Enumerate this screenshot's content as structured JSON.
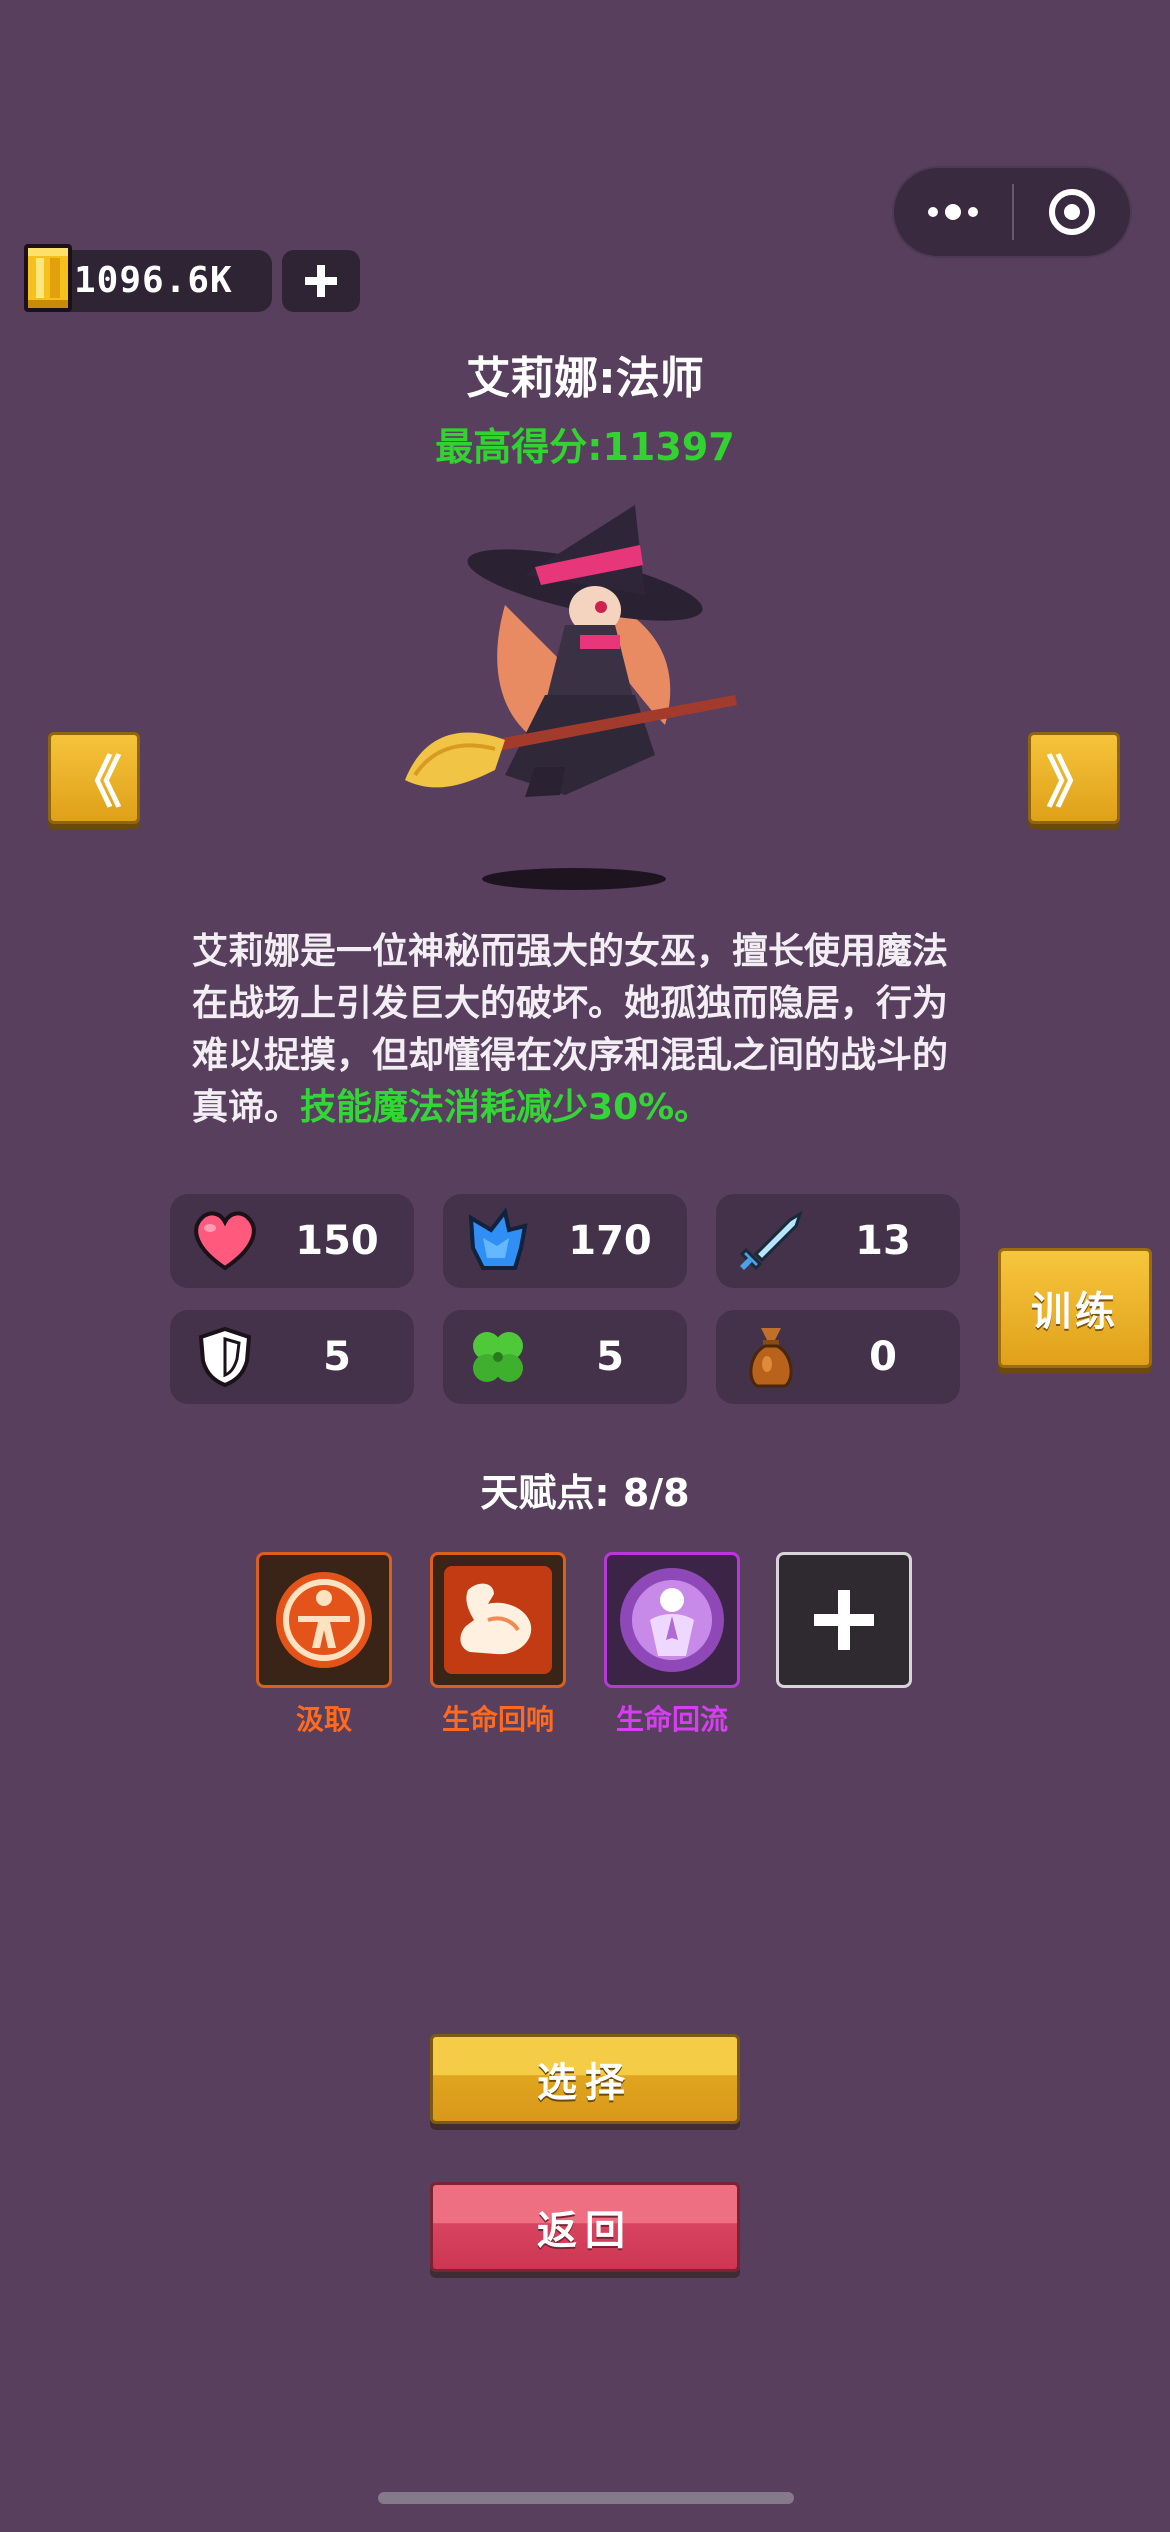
{
  "currency": {
    "amount": "1096.6K"
  },
  "character": {
    "name": "艾莉娜:法师",
    "best_score": "最高得分:11397",
    "description": "艾莉娜是一位神秘而强大的女巫，擅长使用魔法在战场上引发巨大的破坏。她孤独而隐居，行为难以捉摸，但却懂得在次序和混乱之间的战斗的真谛。",
    "skill_highlight": "技能魔法消耗减少30%。"
  },
  "stats": [
    {
      "icon": "heart-icon",
      "value": "150"
    },
    {
      "icon": "mana-crystal-icon",
      "value": "170"
    },
    {
      "icon": "sword-icon",
      "value": "13"
    },
    {
      "icon": "shield-icon",
      "value": "5"
    },
    {
      "icon": "clover-icon",
      "value": "5"
    },
    {
      "icon": "money-bag-icon",
      "value": "0"
    }
  ],
  "buttons": {
    "train": "训练",
    "select": "选择",
    "back": "返回",
    "prev": "《",
    "next": "》"
  },
  "talents": {
    "title": "天赋点: 8/8",
    "items": [
      {
        "label": "汲取",
        "color": "#ff6a1f",
        "icon": "vitruvian-icon"
      },
      {
        "label": "生命回响",
        "color": "#ff6a1f",
        "icon": "muscle-arm-icon"
      },
      {
        "label": "生命回流",
        "color": "#d63ff0",
        "icon": "praying-angel-icon"
      }
    ]
  },
  "colors": {
    "background": "#573f5d",
    "highlight_green": "#32d231",
    "gold_button": "#e7ab22",
    "red_button": "#d84460"
  }
}
